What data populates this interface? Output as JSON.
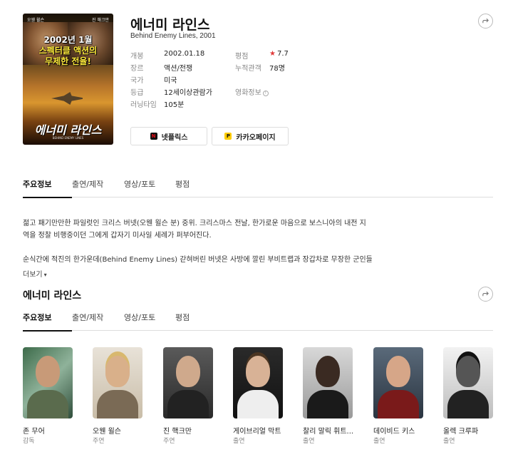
{
  "movie": {
    "title": "에너미 라인스",
    "subtitle": "Behind Enemy Lines, 2001",
    "poster": {
      "top_names": [
        "오웬 윌슨",
        "진 해크만"
      ],
      "tagline_1": "2002년 1월",
      "tagline_2": "스펙터클 액션의",
      "tagline_3": "무제한 전율!",
      "title_ko": "에너미 라인스",
      "title_en": "BEHIND ENEMY LINES"
    }
  },
  "info_left": [
    {
      "key": "개봉",
      "value": "2002.01.18"
    },
    {
      "key": "장르",
      "value": "액션/전쟁"
    },
    {
      "key": "국가",
      "value": "미국"
    },
    {
      "key": "등급",
      "value": "12세이상관람가"
    },
    {
      "key": "러닝타임",
      "value": "105분"
    }
  ],
  "info_right": [
    {
      "key": "평점",
      "value": "7.7"
    },
    {
      "key": "누적관객",
      "value": "78명"
    },
    {
      "key": "영화정보",
      "value": ""
    }
  ],
  "ott": [
    {
      "label": "넷플릭스",
      "icon": "netflix-icon",
      "glyph": "N"
    },
    {
      "label": "카카오페이지",
      "icon": "kakaopage-icon",
      "glyph": "P"
    }
  ],
  "tabs": [
    "주요정보",
    "출연/제작",
    "영상/포토",
    "평점"
  ],
  "synopsis": [
    "젊고 패기만만한 파일럿인 크리스 버넷(오웬 윌슨 분) 중위. 크리스마스 전날, 한가로운 마음으로 보스니아의 내전 지역을 정찰 비행중이던 그에게 갑자기 미사일 세례가 퍼부어진다.",
    "순식간에 적진의 한가운데(Behind Enemy Lines) 갇혀버린 버넷은 사방에 깔린 부비트랩과 장갑차로 무장한 군인들, 저격"
  ],
  "more_label": "더보기",
  "section_title": "에너미 라인스",
  "cast": [
    {
      "name": "존 무어",
      "role": "감독"
    },
    {
      "name": "오웬 윌슨",
      "role": "주연"
    },
    {
      "name": "진 핵크만",
      "role": "주연"
    },
    {
      "name": "게이브리얼 막트",
      "role": "출연"
    },
    {
      "name": "찰리 말릭 휘트...",
      "role": "출연"
    },
    {
      "name": "데이비드 키스",
      "role": "출연"
    },
    {
      "name": "올렉 크루파",
      "role": "출연"
    }
  ],
  "colors": {
    "accent": "#e03a3a",
    "netflix": "#e50914",
    "kakao": "#ffcd00"
  }
}
